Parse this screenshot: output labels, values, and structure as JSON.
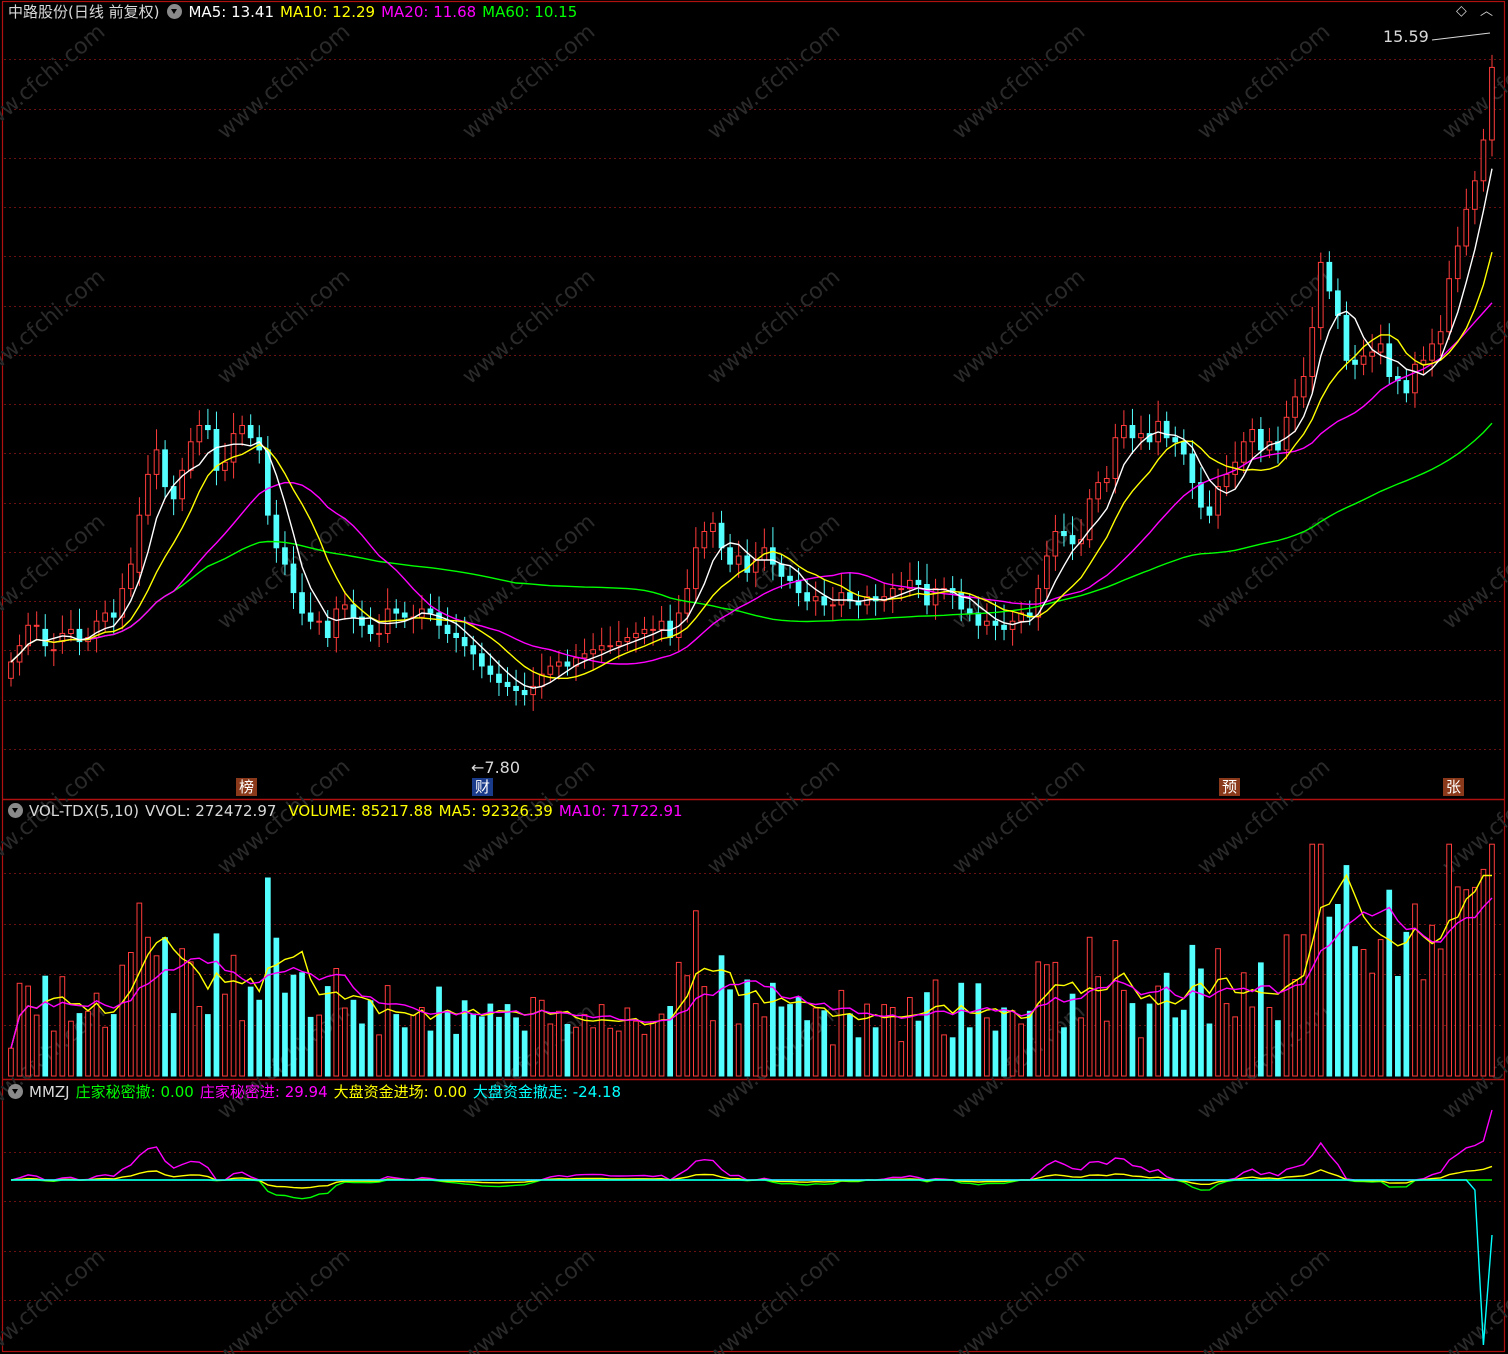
{
  "price_panel": {
    "title": "中路股份(日线 前复权)",
    "ma_labels": [
      {
        "name": "MA5",
        "value": "13.41",
        "color": "#ffffff"
      },
      {
        "name": "MA10",
        "value": "12.29",
        "color": "#ffff00"
      },
      {
        "name": "MA20",
        "value": "11.68",
        "color": "#ff00ff"
      },
      {
        "name": "MA60",
        "value": "10.15",
        "color": "#00ff00"
      }
    ],
    "high_label": "15.59",
    "low_label": "7.80",
    "event_tags": [
      {
        "text": "榜",
        "index": 37
      },
      {
        "text": "财",
        "index": 77
      },
      {
        "text": "预",
        "index": 201
      },
      {
        "text": "张",
        "index": 237
      }
    ],
    "top_right_icons": [
      "diamond-icon",
      "chevron-up-icon"
    ]
  },
  "volume_panel": {
    "name": "VOL-TDX(5,10)",
    "vvol_label": "VVOL:",
    "vvol_value": "272472.97",
    "volume_label": "VOLUME:",
    "volume_value": "85217.88",
    "ma5_label": "MA5:",
    "ma5_value": "92326.39",
    "ma10_label": "MA10:",
    "ma10_value": "71722.91"
  },
  "indicator_panel": {
    "name": "MMZJ",
    "items": [
      {
        "label": "庄家秘密撤:",
        "value": "0.00",
        "color": "#00ff00"
      },
      {
        "label": "庄家秘密进:",
        "value": "29.94",
        "color": "#ff00ff"
      },
      {
        "label": "大盘资金进场:",
        "value": "0.00",
        "color": "#ffff00"
      },
      {
        "label": "大盘资金撤走:",
        "value": "-24.18",
        "color": "#00ffff"
      }
    ]
  },
  "colors": {
    "up": "#ff3b3b",
    "down": "#54ffff",
    "ma5": "#ffffff",
    "ma10": "#ffff00",
    "ma20": "#ff00ff",
    "ma60": "#00ff00",
    "frame": "#b01010",
    "grid": "#6a1010"
  },
  "chart_data": [
    {
      "type": "candlestick",
      "ylim": [
        7.0,
        16.0
      ],
      "high": 15.59,
      "low": 7.8,
      "closes": [
        8.3,
        8.5,
        8.75,
        8.75,
        8.5,
        8.45,
        8.65,
        8.7,
        8.55,
        8.6,
        8.8,
        8.9,
        8.85,
        9.2,
        9.5,
        10.1,
        10.6,
        10.9,
        10.45,
        10.3,
        10.65,
        11.0,
        11.2,
        11.15,
        10.65,
        10.75,
        11.1,
        11.2,
        11.05,
        10.9,
        10.1,
        9.7,
        9.5,
        9.15,
        8.9,
        8.8,
        8.8,
        8.6,
        8.95,
        9.0,
        8.85,
        8.75,
        8.65,
        8.65,
        8.95,
        8.9,
        8.85,
        8.85,
        8.95,
        8.9,
        8.75,
        8.65,
        8.6,
        8.5,
        8.4,
        8.25,
        8.15,
        8.05,
        8.0,
        7.95,
        7.9,
        8.0,
        8.15,
        8.25,
        8.3,
        8.25,
        8.35,
        8.4,
        8.45,
        8.5,
        8.5,
        8.55,
        8.6,
        8.65,
        8.7,
        8.7,
        8.8,
        8.6,
        8.9,
        9.2,
        9.7,
        9.9,
        10.0,
        9.7,
        9.5,
        9.6,
        9.4,
        9.55,
        9.7,
        9.5,
        9.35,
        9.3,
        9.15,
        9.05,
        9.1,
        9.0,
        9.0,
        9.15,
        9.05,
        9.0,
        9.1,
        9.05,
        9.1,
        9.2,
        9.2,
        9.3,
        9.25,
        9.0,
        9.2,
        9.2,
        9.15,
        8.95,
        8.9,
        8.75,
        8.8,
        8.75,
        8.7,
        8.8,
        8.9,
        8.85,
        9.2,
        9.6,
        9.9,
        9.85,
        9.75,
        9.8,
        10.3,
        10.5,
        10.55,
        11.05,
        11.2,
        11.05,
        11.1,
        11.0,
        11.25,
        11.05,
        11.0,
        10.85,
        10.5,
        10.2,
        10.1,
        10.45,
        10.6,
        10.75,
        11.0,
        11.15,
        10.9,
        11.0,
        10.9,
        11.3,
        11.55,
        11.8,
        12.4,
        13.2,
        12.85,
        12.55,
        12.0,
        11.95,
        12.05,
        12.1,
        12.2,
        11.8,
        11.75,
        11.6,
        11.95,
        12.0,
        12.2,
        12.35,
        13.0,
        13.4,
        13.85,
        14.2,
        14.7,
        15.59
      ],
      "opens": [
        8.1,
        8.3,
        8.5,
        8.75,
        8.7,
        8.45,
        8.55,
        8.65,
        8.7,
        8.55,
        8.6,
        8.8,
        8.9,
        8.85,
        9.2,
        9.4,
        10.1,
        10.6,
        10.9,
        10.45,
        10.3,
        10.65,
        11.0,
        11.2,
        11.15,
        10.65,
        10.75,
        11.1,
        11.2,
        11.05,
        10.9,
        10.1,
        9.7,
        9.5,
        9.15,
        8.9,
        8.8,
        8.8,
        8.6,
        8.95,
        9.0,
        8.85,
        8.75,
        8.65,
        8.65,
        8.95,
        8.9,
        8.85,
        8.85,
        8.95,
        8.9,
        8.75,
        8.65,
        8.6,
        8.5,
        8.4,
        8.25,
        8.15,
        8.05,
        8.0,
        7.95,
        7.9,
        8.0,
        8.15,
        8.25,
        8.3,
        8.25,
        8.35,
        8.4,
        8.45,
        8.5,
        8.5,
        8.55,
        8.6,
        8.65,
        8.7,
        8.7,
        8.8,
        8.6,
        8.9,
        9.2,
        9.7,
        9.9,
        10.0,
        9.7,
        9.5,
        9.6,
        9.4,
        9.55,
        9.7,
        9.5,
        9.35,
        9.3,
        9.15,
        9.05,
        9.1,
        9.0,
        9.0,
        9.15,
        9.05,
        9.0,
        9.1,
        9.05,
        9.1,
        9.2,
        9.2,
        9.3,
        9.25,
        9.0,
        9.2,
        9.2,
        9.15,
        8.95,
        8.9,
        8.75,
        8.8,
        8.75,
        8.7,
        8.8,
        8.9,
        8.85,
        9.2,
        9.6,
        9.9,
        9.85,
        9.75,
        9.8,
        10.3,
        10.5,
        10.55,
        11.05,
        11.2,
        11.05,
        11.1,
        11.0,
        11.25,
        11.05,
        11.0,
        10.85,
        10.5,
        10.2,
        10.1,
        10.45,
        10.6,
        10.75,
        11.0,
        11.15,
        10.9,
        11.0,
        10.9,
        11.3,
        11.55,
        11.8,
        12.4,
        13.2,
        12.85,
        12.55,
        12.0,
        11.95,
        12.05,
        12.1,
        12.2,
        11.8,
        11.75,
        11.6,
        11.95,
        12.0,
        12.2,
        12.35,
        13.0,
        13.4,
        13.85,
        14.2,
        14.7
      ]
    },
    {
      "type": "bar",
      "name": "VOL-TDX(5,10)",
      "vvol": 272472.97,
      "volume": 85217.88,
      "ma5": 92326.39,
      "ma10": 71722.91
    },
    {
      "type": "line",
      "name": "MMZJ",
      "series": [
        {
          "name": "庄家秘密撤",
          "last": 0.0
        },
        {
          "name": "庄家秘密进",
          "last": 29.94
        },
        {
          "name": "大盘资金进场",
          "last": 0.0
        },
        {
          "name": "大盘资金撤走",
          "last": -24.18
        }
      ]
    }
  ]
}
